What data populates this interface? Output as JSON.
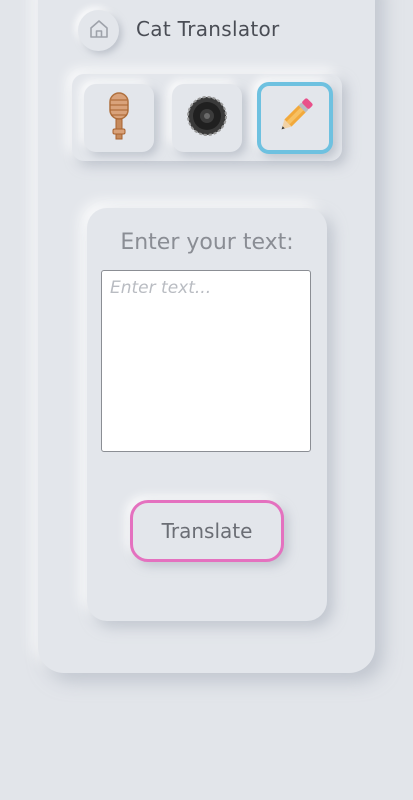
{
  "header": {
    "title": "Cat Translator",
    "home_icon": "home-icon"
  },
  "modes": [
    {
      "icon": "microphone-icon",
      "active": false
    },
    {
      "icon": "speaker-icon",
      "active": false
    },
    {
      "icon": "pencil-icon",
      "active": true
    }
  ],
  "input_card": {
    "heading": "Enter your text:",
    "placeholder": "Enter text...",
    "value": "",
    "button_label": "Translate"
  },
  "colors": {
    "background": "#e2e5ea",
    "active_mode_border": "#6ec1e0",
    "translate_border": "#e471bf"
  }
}
